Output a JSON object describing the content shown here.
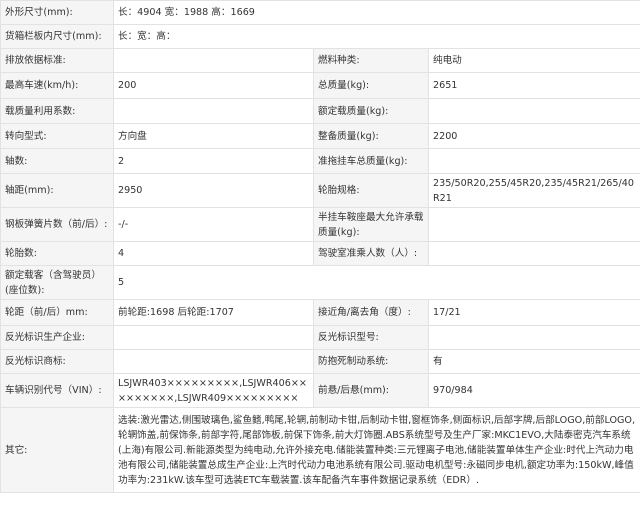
{
  "spec": {
    "dims_label": "外形尺寸(mm):",
    "dims_value": "长：4904 宽：1988 高：1669",
    "cargo_label": "货箱栏板内尺寸(mm):",
    "cargo_value": "长：宽：高：",
    "emission_label": "排放依据标准:",
    "emission_value": "",
    "fuel_label": "燃料种类:",
    "fuel_value": "纯电动",
    "speed_label": "最高车速(km/h):",
    "speed_value": "200",
    "total_mass_label": "总质量(kg):",
    "total_mass_value": "2651",
    "load_util_label": "载质量利用系数:",
    "load_util_value": "",
    "rated_load_label": "额定载质量(kg):",
    "rated_load_value": "",
    "steering_label": "转向型式:",
    "steering_value": "方向盘",
    "curb_mass_label": "整备质量(kg):",
    "curb_mass_value": "2200",
    "axles_label": "轴数:",
    "axles_value": "2",
    "trailer_mass_label": "准拖挂车总质量(kg):",
    "trailer_mass_value": "",
    "wheelbase_label": "轴距(mm):",
    "wheelbase_value": "2950",
    "tire_label": "轮胎规格:",
    "tire_value": "235/50R20,255/45R20,235/45R21/265/40R21",
    "leaf_label": "钢板弹簧片数（前/后）:",
    "leaf_value": "-/-",
    "semi_label": "半挂车鞍座最大允许承载质量(kg):",
    "semi_value": "",
    "tire_count_label": "轮胎数:",
    "tire_count_value": "4",
    "cab_label": "驾驶室准乘人数（人）:",
    "cab_value": "",
    "seats_label": "额定载客（含驾驶员）(座位数):",
    "seats_value": "5",
    "track_label": "轮距（前/后）mm:",
    "track_value": "前轮距:1698 后轮距:1707",
    "angle_label": "接近角/离去角（度）:",
    "angle_value": "17/21",
    "reflector_maker_label": "反光标识生产企业:",
    "reflector_maker_value": "",
    "reflector_model_label": "反光标识型号:",
    "reflector_model_value": "",
    "reflector_brand_label": "反光标识商标:",
    "reflector_brand_value": "",
    "abs_label": "防抱死制动系统:",
    "abs_value": "有",
    "vin_label": "车辆识别代号（VIN）:",
    "vin_value": "LSJWR403×××××××××,LSJWR406×××××××××,LSJWR409×××××××××",
    "overhang_label": "前悬/后悬(mm):",
    "overhang_value": "970/984",
    "other_label": "其它:",
    "other_value": "选装:激光雷达,侧围玻璃色,鲨鱼鳍,鸭尾,轮辋,前制动卡钳,后制动卡钳,窗框饰条,侧面标识,后部字牌,后部LOGO,前部LOGO,轮辋饰盖,前保饰条,前部字符,尾部饰板,前保下饰条,前大灯饰圈.ABS系统型号及生产厂家:MKC1EVO,大陆泰密克汽车系统(上海)有限公司.新能源类型为纯电动,允许外接充电.储能装置种类:三元锂离子电池,储能装置单体生产企业:时代上汽动力电池有限公司,储能装置总成生产企业:上汽时代动力电池系统有限公司.驱动电机型号:永磁同步电机,额定功率为:150kW,峰值功率为:231kW.该车型可选装ETC车载装置.该车配备汽车事件数据记录系统（EDR）."
  }
}
